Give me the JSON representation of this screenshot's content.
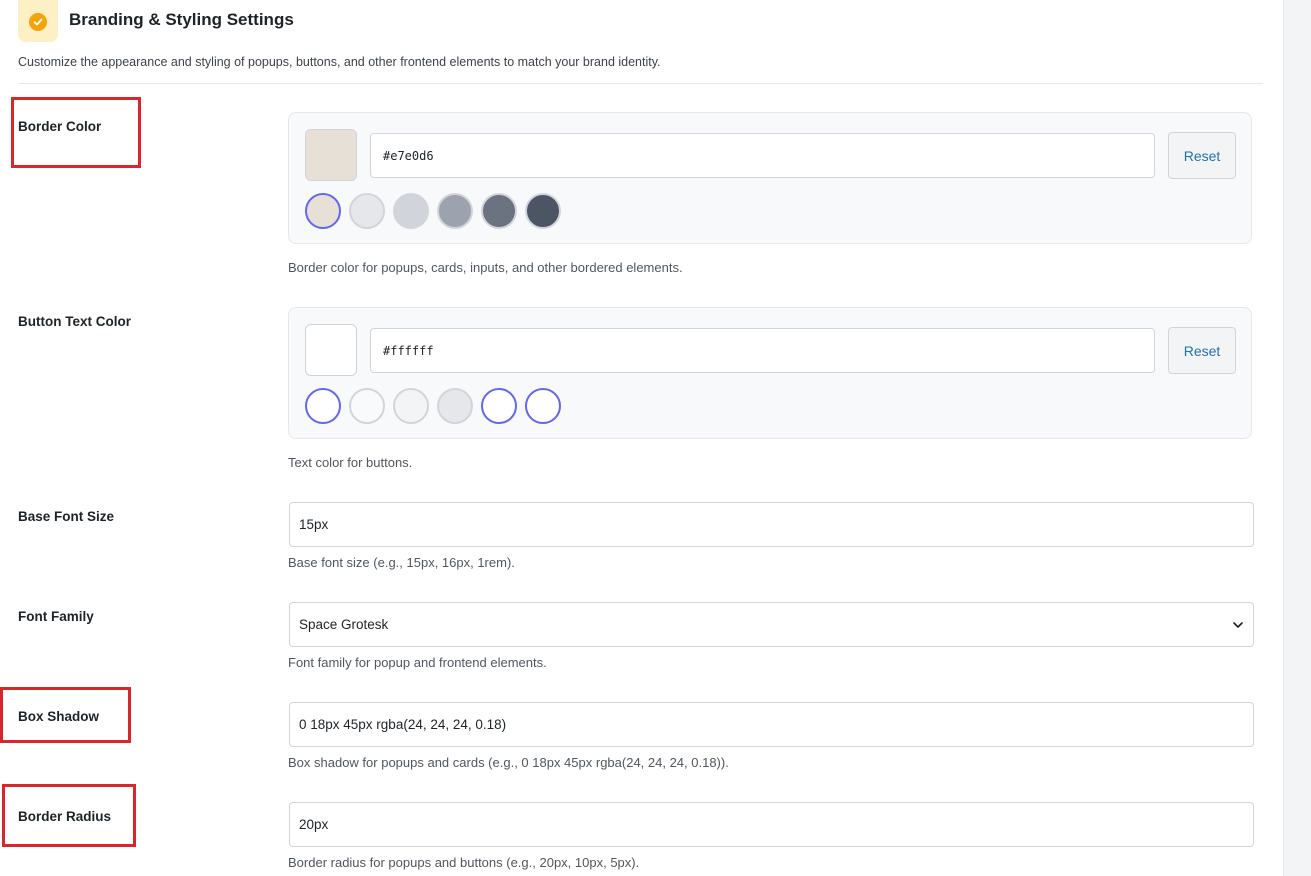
{
  "header": {
    "title": "Branding & Styling Settings",
    "description": "Customize the appearance and styling of popups, buttons, and other frontend elements to match your brand identity.",
    "icon": "check-circle-icon",
    "icon_color": "#f5a30a"
  },
  "border_color": {
    "label": "Border Color",
    "value": "#e7e0d6",
    "reset_label": "Reset",
    "help": "Border color for popups, cards, inputs, and other bordered elements.",
    "presets": [
      "#e7e0d6",
      "#e5e7eb",
      "#d1d5db",
      "#9ca3af",
      "#6b7280",
      "#4b5563"
    ],
    "selected_preset": 0
  },
  "button_text_color": {
    "label": "Button Text Color",
    "value": "#ffffff",
    "reset_label": "Reset",
    "help": "Text color for buttons.",
    "presets": [
      "#ffffff",
      "#f9fafb",
      "#f3f4f6",
      "#e5e7eb",
      "#ffffff",
      "#ffffff"
    ],
    "selected_presets": [
      0,
      4,
      5
    ]
  },
  "base_font_size": {
    "label": "Base Font Size",
    "value": "15px",
    "help": "Base font size (e.g., 15px, 16px, 1rem)."
  },
  "font_family": {
    "label": "Font Family",
    "value": "Space Grotesk",
    "help": "Font family for popup and frontend elements."
  },
  "box_shadow": {
    "label": "Box Shadow",
    "value": "0 18px 45px rgba(24, 24, 24, 0.18)",
    "help": "Box shadow for popups and cards (e.g., 0 18px 45px rgba(24, 24, 24, 0.18))."
  },
  "border_radius": {
    "label": "Border Radius",
    "value": "20px",
    "help": "Border radius for popups and buttons (e.g., 20px, 10px, 5px)."
  },
  "highlight_color": "#d9262a",
  "accent_color": "#6366f1"
}
